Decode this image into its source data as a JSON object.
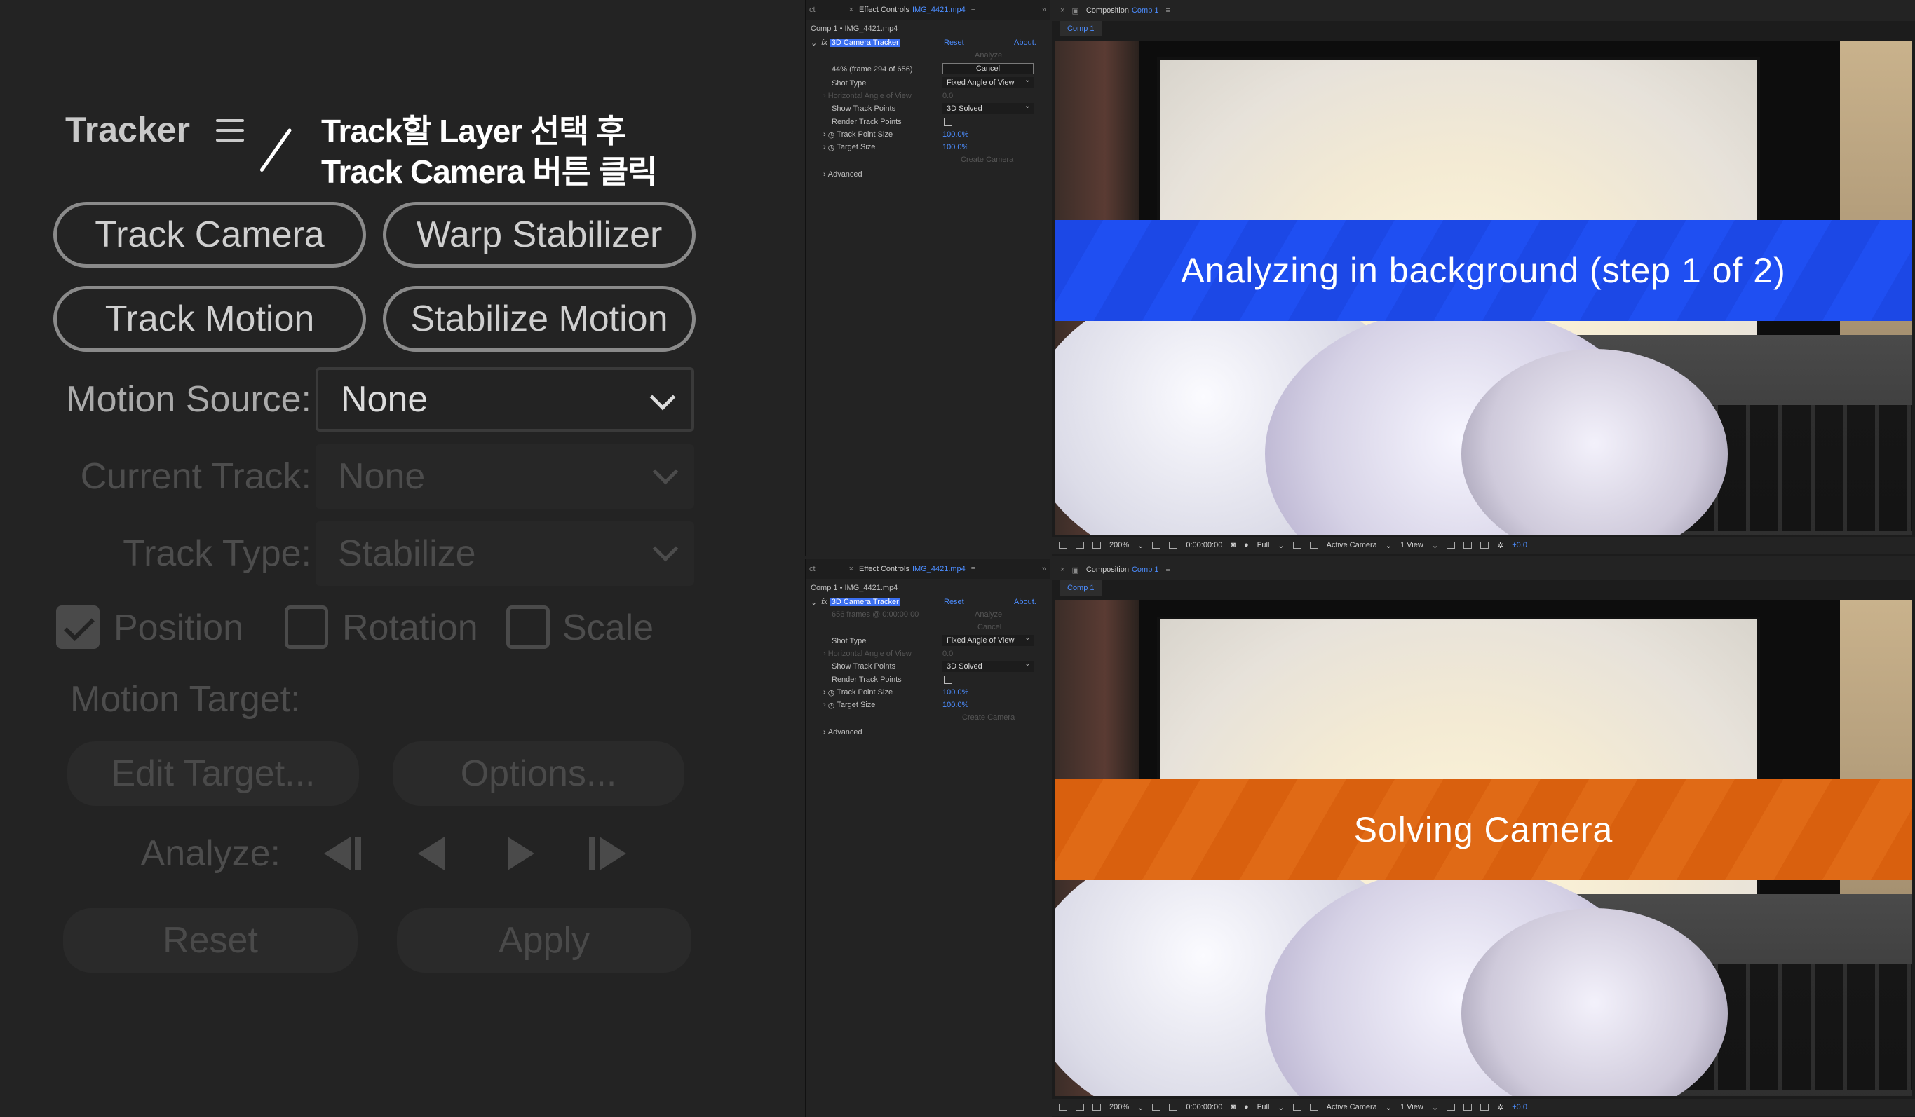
{
  "tracker": {
    "title": "Tracker",
    "annotation_line1": "Track할 Layer 선택 후",
    "annotation_line2": "Track Camera 버튼 클릭",
    "buttons": {
      "track_camera": "Track Camera",
      "warp_stabilizer": "Warp Stabilizer",
      "track_motion": "Track Motion",
      "stabilize_motion": "Stabilize Motion"
    },
    "motion_source_label": "Motion Source:",
    "motion_source_value": "None",
    "current_track_label": "Current Track:",
    "current_track_value": "None",
    "track_type_label": "Track Type:",
    "track_type_value": "Stabilize",
    "checkboxes": {
      "position": "Position",
      "rotation": "Rotation",
      "scale": "Scale"
    },
    "motion_target_label": "Motion Target:",
    "edit_target": "Edit Target...",
    "options": "Options...",
    "analyze_label": "Analyze:",
    "reset": "Reset",
    "apply": "Apply"
  },
  "top": {
    "effect_controls": {
      "tab_left": "ct",
      "tab_title": "Effect Controls",
      "tab_file": "IMG_4421.mp4",
      "layer_path": "Comp 1 • IMG_4421.mp4",
      "effect_name": "3D Camera Tracker",
      "reset": "Reset",
      "about": "About.",
      "analyze": "Analyze",
      "status": "44% (frame 294 of 656)",
      "cancel": "Cancel",
      "shot_type_label": "Shot Type",
      "shot_type_value": "Fixed Angle of View",
      "hav_label": "Horizontal Angle of View",
      "hav_value": "0.0",
      "show_tp_label": "Show Track Points",
      "show_tp_value": "3D Solved",
      "render_tp_label": "Render Track Points",
      "tp_size_label": "Track Point Size",
      "tp_size_value": "100.0%",
      "target_size_label": "Target Size",
      "target_size_value": "100.0%",
      "create_camera": "Create Camera",
      "advanced": "Advanced"
    },
    "composition": {
      "tab_title": "Composition",
      "tab_comp": "Comp 1",
      "subtab": "Comp 1",
      "banner": "Analyzing in background (step 1 of 2)",
      "zoom": "200%",
      "timecode": "0:00:00:00",
      "resolution": "Full",
      "camera": "Active Camera",
      "views": "1 View",
      "exposure": "+0.0"
    }
  },
  "bottom": {
    "effect_controls": {
      "tab_left": "ct",
      "tab_title": "Effect Controls",
      "tab_file": "IMG_4421.mp4",
      "layer_path": "Comp 1 • IMG_4421.mp4",
      "effect_name": "3D Camera Tracker",
      "reset": "Reset",
      "about": "About.",
      "status": "656 frames @ 0:00:00:00",
      "analyze": "Analyze",
      "cancel": "Cancel",
      "shot_type_label": "Shot Type",
      "shot_type_value": "Fixed Angle of View",
      "hav_label": "Horizontal Angle of View",
      "hav_value": "0.0",
      "show_tp_label": "Show Track Points",
      "show_tp_value": "3D Solved",
      "render_tp_label": "Render Track Points",
      "tp_size_label": "Track Point Size",
      "tp_size_value": "100.0%",
      "target_size_label": "Target Size",
      "target_size_value": "100.0%",
      "create_camera": "Create Camera",
      "advanced": "Advanced"
    },
    "composition": {
      "tab_title": "Composition",
      "tab_comp": "Comp 1",
      "subtab": "Comp 1",
      "banner": "Solving Camera",
      "zoom": "200%",
      "timecode": "0:00:00:00",
      "resolution": "Full",
      "camera": "Active Camera",
      "views": "1 View",
      "exposure": "+0.0"
    }
  },
  "colors": {
    "analyzing_banner": "#1f4ff2",
    "solving_banner": "#e06a16",
    "accent_blue": "#4c8dff"
  }
}
